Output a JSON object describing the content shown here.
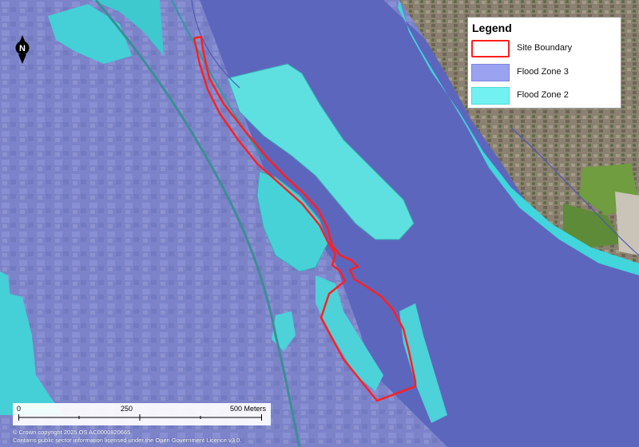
{
  "legend": {
    "title": "Legend",
    "items": [
      {
        "label": "Site Boundary",
        "fill": "#ffffff",
        "stroke": "#ff1e1e"
      },
      {
        "label": "Flood Zone 3",
        "fill": "#9aa3f0",
        "stroke": "#7c86dd"
      },
      {
        "label": "Flood Zone 2",
        "fill": "#71f1f1",
        "stroke": "#52d8d8"
      }
    ]
  },
  "north_arrow": {
    "letter": "N"
  },
  "scale_bar": {
    "labels": [
      "0",
      "250",
      "500 Meters"
    ]
  },
  "copyright": {
    "line1": "© Crown copyright 2025 OS AC0000820665",
    "line2": "Contains public sector information licensed under the Open Government Licence v3.0."
  },
  "colors": {
    "flood_zone_3": "#6e78d0",
    "flood_zone_2": "#45d3d8",
    "site_boundary": "#ff2020",
    "river": "#5c65bb",
    "urban": "#7d84c6",
    "suburb": "#8a7f6c",
    "fields": "#5f8a3e"
  }
}
